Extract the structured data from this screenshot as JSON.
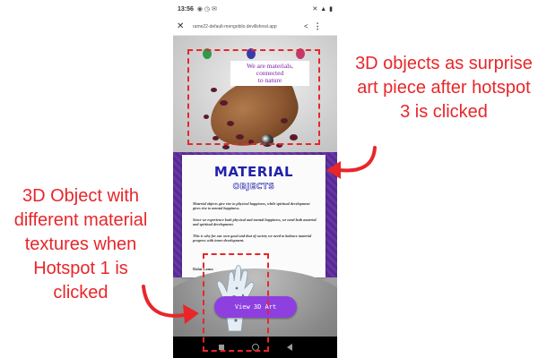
{
  "status_bar": {
    "time": "13:56"
  },
  "browser": {
    "url": "rame22-default-mengobilo.devillshowl.app"
  },
  "art_piece": {
    "caption_line1": "We are materials,",
    "caption_line2": "connected",
    "caption_line3": "to nature"
  },
  "board": {
    "title": "MATERIAL",
    "subtitle": "OBJECTS",
    "para1": "Material objects give rise to physical happiness, while spiritual development gives rise to mental happiness.",
    "para2": "Since we experience both physical and mental happiness, we need both material and spiritual development.",
    "para3": "This is why for our own good and that of society we need to balance material progress with inner development.",
    "signature": "Dalai Lama"
  },
  "view_button_label": "View 3D Art",
  "annotations": {
    "right": "3D objects as surprise art piece after hotspot 3 is clicked",
    "left": "3D Object with different material textures when Hotspot 1 is clicked"
  },
  "colors": {
    "annotation_red": "#e8262a",
    "button_purple": "#8e3fe0",
    "board_title_blue": "#2222aa",
    "frame_purple": "#6b35b0"
  }
}
